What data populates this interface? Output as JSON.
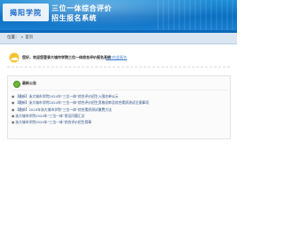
{
  "header": {
    "logo_text": "揭阳学院",
    "title_line1": "三位一体综合评价",
    "title_line2": "招生报名系统"
  },
  "breadcrumb": {
    "label": "位置：",
    "sep": "»",
    "current": "首页"
  },
  "notice": {
    "text": "您好，欢迎您登录大城市学院三位一体综合评价报名系统",
    "link": "入口在此报名"
  },
  "announcements": {
    "title": "最新公告",
    "items": [
      "【最新】浙大城市学院2024年“三位一体”综合评价招生入围名单公示",
      "【最新】浙大城市学院2024年“三位一体”综合评价招生资格初审及综合素质测试注意事项",
      "【最新】2024年浙大城市学院“三位一体”综合素质测试缴费方法",
      "浙大城市学院2024年“三位一体”常见问题汇总",
      "浙大城市学院2024年“三位一体”综合评价招生简章"
    ],
    "bullet": "●"
  }
}
